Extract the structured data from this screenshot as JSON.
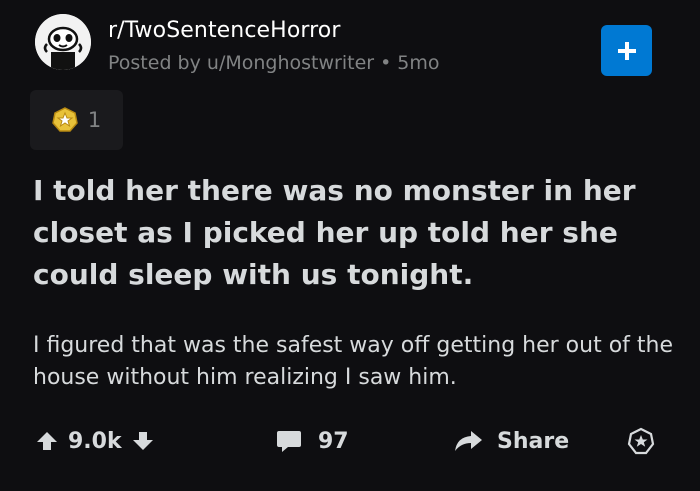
{
  "header": {
    "subreddit": "r/TwoSentenceHorror",
    "posted_by_prefix": "Posted by",
    "author": "u/Monghostwriter",
    "separator": "•",
    "age": "5mo",
    "join_icon": "plus-icon"
  },
  "awards": {
    "icon": "award-icon",
    "count": "1"
  },
  "post": {
    "title": "I told her there was no monster in her closet as I picked her up told her she could sleep with us tonight.",
    "body": "I figured that was the safest way off getting her out of the house without him realizing I saw him."
  },
  "actions": {
    "score": "9.0k",
    "comments": "97",
    "share_label": "Share"
  },
  "colors": {
    "background": "#0e0e11",
    "accent": "#0079d3",
    "text": "#d7dadc",
    "muted": "#818384"
  }
}
